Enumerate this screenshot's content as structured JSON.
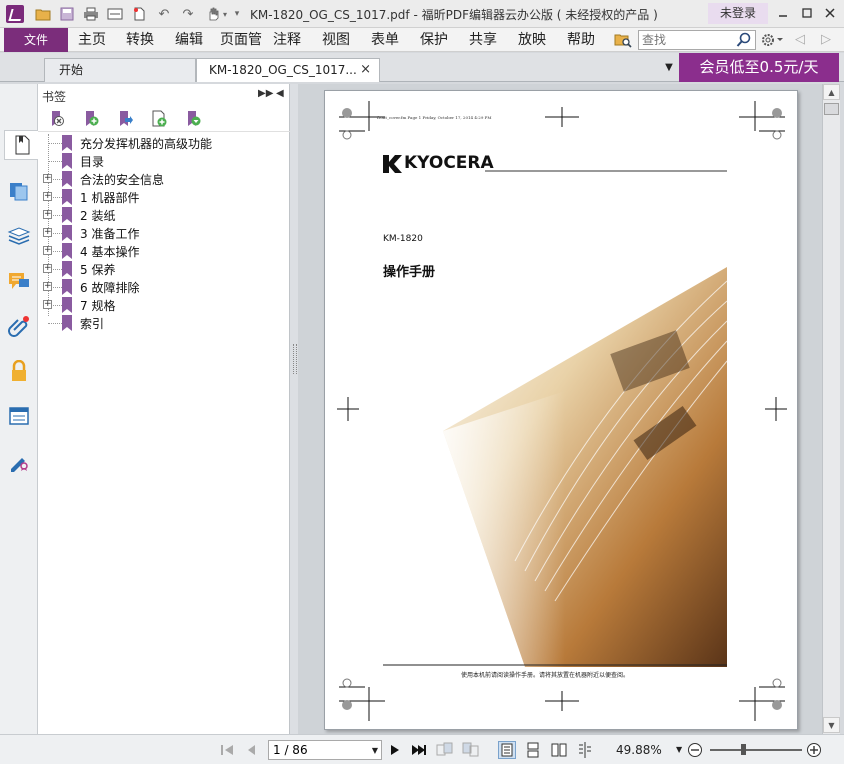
{
  "window": {
    "title": "KM-1820_OG_CS_1017.pdf - 福昕PDF编辑器云办公版 ( 未经授权的产品 )",
    "login_label": "未登录"
  },
  "menu": {
    "file_label": "文件",
    "items": [
      "主页",
      "转换",
      "编辑",
      "页面管",
      "注释",
      "视图",
      "表单",
      "保护",
      "共享",
      "放映",
      "帮助"
    ],
    "search_placeholder": "查找"
  },
  "tabs": [
    {
      "label": "开始",
      "active": false
    },
    {
      "label": "KM-1820_OG_CS_1017...",
      "active": true,
      "close": "×"
    }
  ],
  "promo": {
    "label": "会员低至0.5元/天"
  },
  "bookmark_panel": {
    "title": "书签",
    "items": [
      {
        "label": "充分发挥机器的高级功能",
        "expandable": false
      },
      {
        "label": "目录",
        "expandable": false
      },
      {
        "label": "合法的安全信息",
        "expandable": true
      },
      {
        "label": "1 机器部件",
        "expandable": true
      },
      {
        "label": "2 装纸",
        "expandable": true
      },
      {
        "label": "3 准备工作",
        "expandable": true
      },
      {
        "label": "4 基本操作",
        "expandable": true
      },
      {
        "label": "5 保养",
        "expandable": true
      },
      {
        "label": "6 故障排除",
        "expandable": true
      },
      {
        "label": "7 规格",
        "expandable": true
      },
      {
        "label": "索引",
        "expandable": false
      }
    ]
  },
  "document_page": {
    "header_line": "front_cover.fm Page 1 Friday, October 17, 2014 4:29 PM",
    "brand": "KYOCERA",
    "model": "KM-1820",
    "doc_title": "操作手册",
    "footer_note": "使用本机前请阅读操作手册。请将其放置在机器附近以便查阅。"
  },
  "statusbar": {
    "page_value": "1 / 86",
    "zoom": "49.88%",
    "zoom_level_fraction": 0.36
  },
  "colors": {
    "brand_purple": "#7b2d7b",
    "promo_purple": "#8b2e8d",
    "bookmark_purple": "#8a5ba0"
  }
}
